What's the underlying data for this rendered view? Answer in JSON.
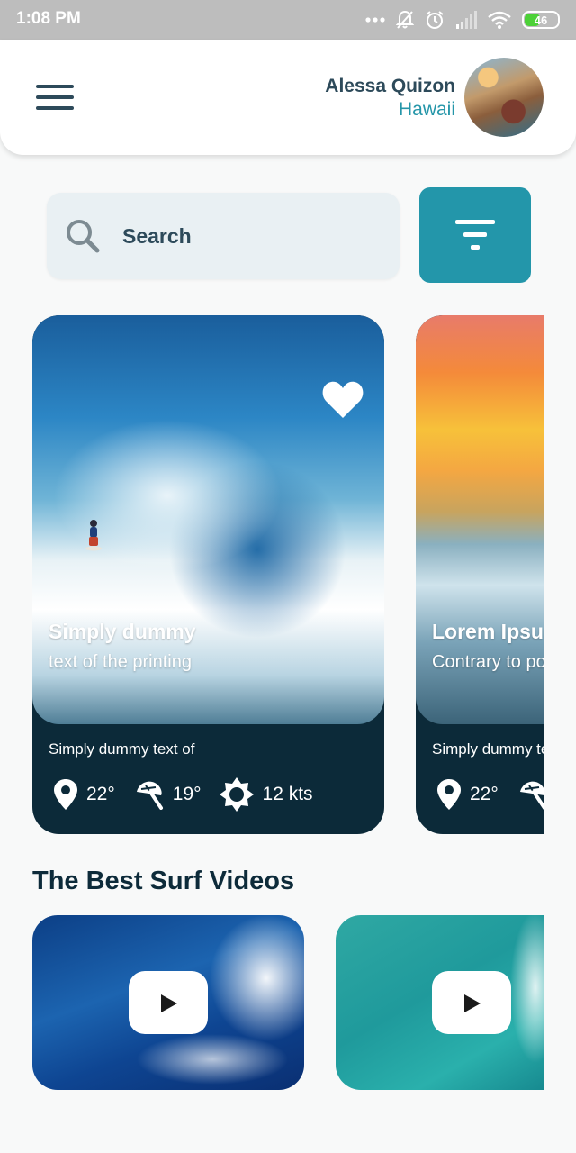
{
  "status_bar": {
    "time": "1:08 PM",
    "battery_text": "46",
    "battery_level": 0.46,
    "icons": [
      "more-dots-icon",
      "muted-bell-icon",
      "alarm-icon",
      "signal-icon",
      "wifi-icon",
      "battery-icon"
    ]
  },
  "header": {
    "menu_icon": "hamburger-menu-icon",
    "user_name": "Alessa Quizon",
    "user_location": "Hawaii"
  },
  "search": {
    "placeholder": "Search",
    "icon": "search-icon",
    "filter_icon": "filter-icon"
  },
  "cards": [
    {
      "title": "Simply dummy",
      "subtitle": "text of the printing",
      "caption": "Simply dummy text of",
      "favorite": true,
      "stats": {
        "location_temp": "22°",
        "beach_temp": "19°",
        "wind": "12 kts"
      }
    },
    {
      "title": "Lorem Ipsum",
      "subtitle": "Contrary to popular",
      "caption": "Simply dummy text of",
      "stats": {
        "location_temp": "22°"
      }
    }
  ],
  "videos_section": {
    "title": "The Best Surf Videos",
    "videos": [
      {
        "icon": "play-icon"
      },
      {
        "icon": "play-icon"
      }
    ]
  },
  "colors": {
    "accent": "#2396aa",
    "card_bg": "#0c2a39",
    "text_dark": "#2d4a5a",
    "location_text": "#2596a9"
  }
}
